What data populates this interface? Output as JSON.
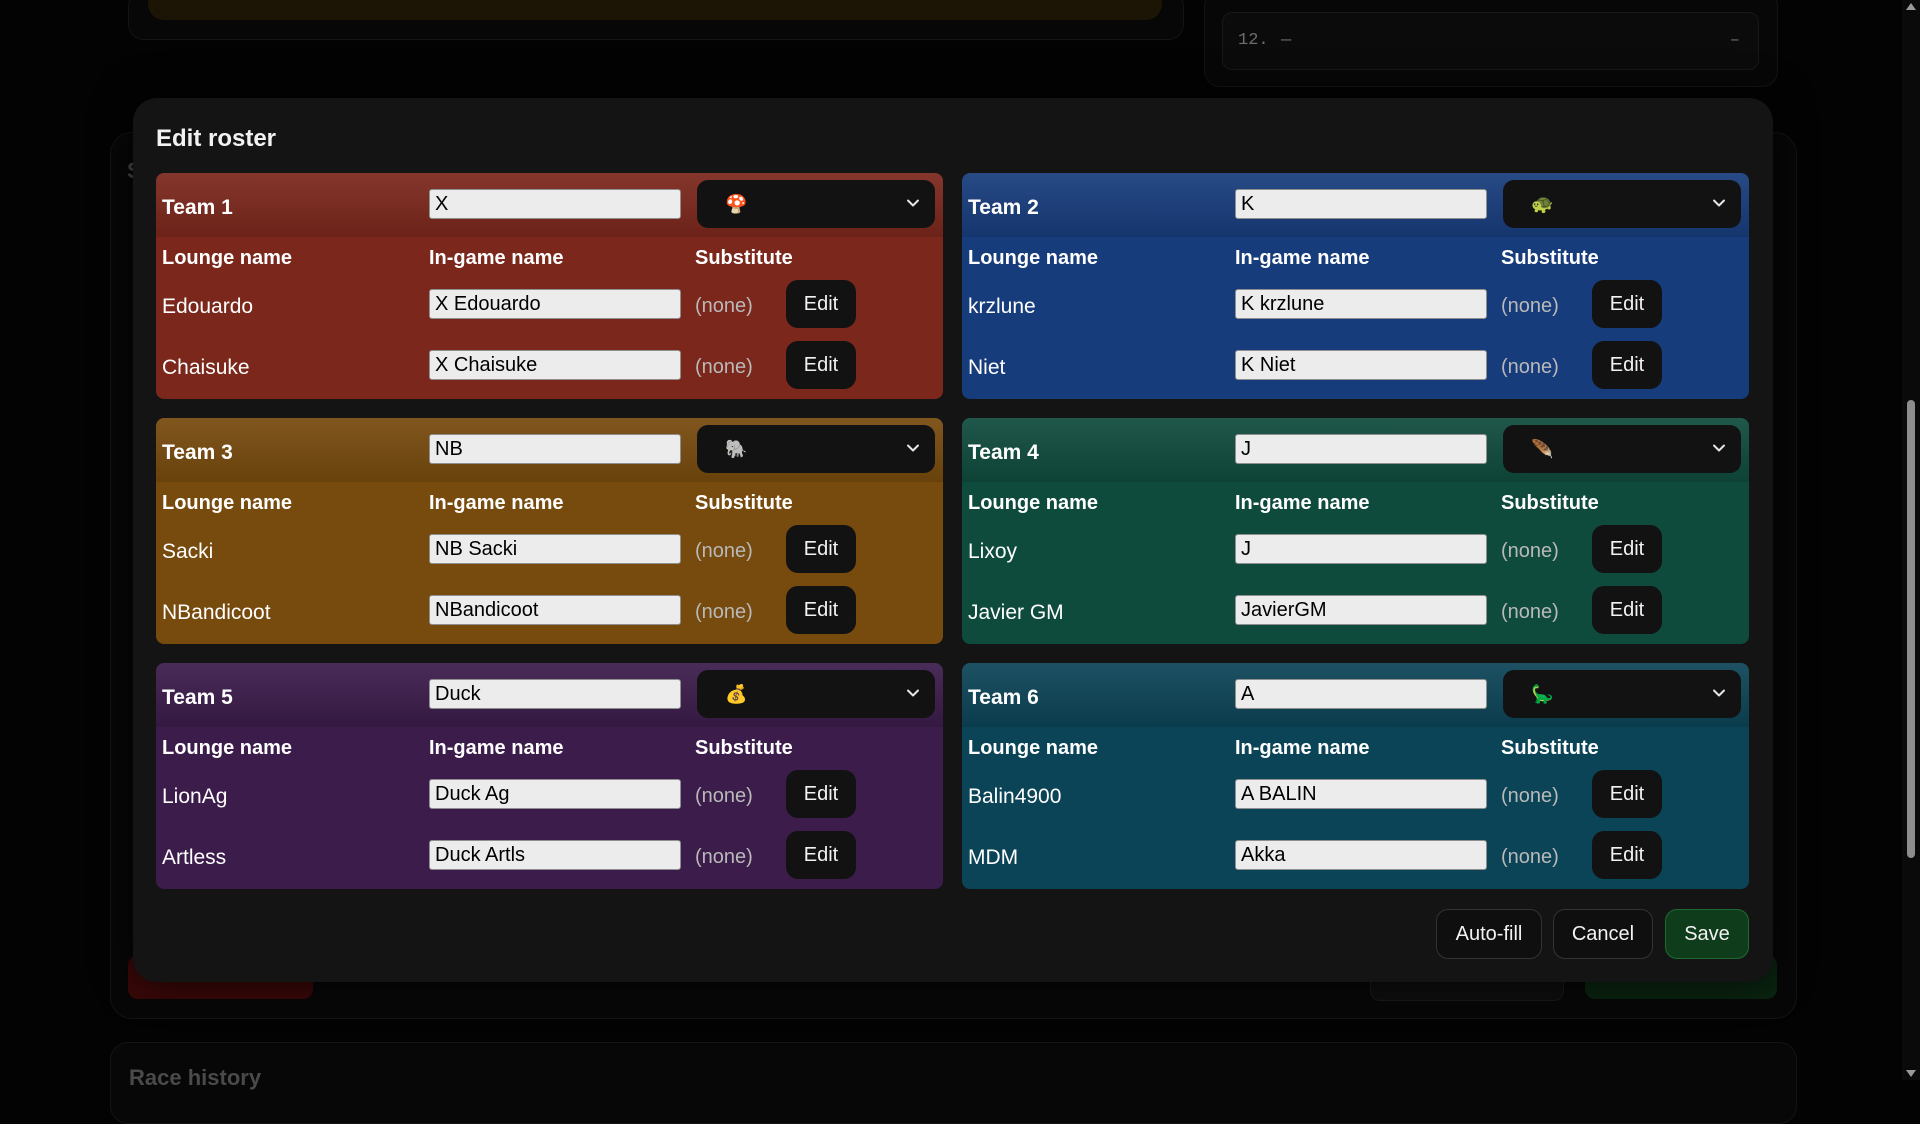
{
  "background": {
    "list_row": {
      "number": "12.",
      "name": "—",
      "value": "–"
    },
    "section_initial": "S",
    "race_history_title": "Race history"
  },
  "modal": {
    "title": "Edit roster",
    "column_headers": {
      "lounge": "Lounge name",
      "ingame": "In-game name",
      "substitute": "Substitute"
    },
    "none_label": "(none)",
    "edit_label": "Edit",
    "teams": [
      {
        "name": "Team 1",
        "tag": "X",
        "icon": "🍄",
        "color": "#7b271c",
        "players": [
          {
            "lounge": "Edouardo",
            "ingame": "X Edouardo"
          },
          {
            "lounge": "Chaisuke",
            "ingame": "X Chaisuke"
          }
        ]
      },
      {
        "name": "Team 2",
        "tag": "K",
        "icon": "🐢",
        "color": "#173c7c",
        "players": [
          {
            "lounge": "krzlune",
            "ingame": "K krzlune"
          },
          {
            "lounge": "Niet",
            "ingame": "K Niet"
          }
        ]
      },
      {
        "name": "Team 3",
        "tag": "NB",
        "icon": "🐘",
        "color": "#774a0d",
        "players": [
          {
            "lounge": "Sacki",
            "ingame": "NB Sacki"
          },
          {
            "lounge": "NBandicoot",
            "ingame": "NBandicoot"
          }
        ]
      },
      {
        "name": "Team 4",
        "tag": "J",
        "icon": "🪶",
        "color": "#0f4b3d",
        "players": [
          {
            "lounge": "Lixoy",
            "ingame": "J"
          },
          {
            "lounge": "Javier GM",
            "ingame": "JavierGM"
          }
        ]
      },
      {
        "name": "Team 5",
        "tag": "Duck",
        "icon": "💰",
        "color": "#3b1c4b",
        "players": [
          {
            "lounge": "LionAg",
            "ingame": "Duck Ag"
          },
          {
            "lounge": "Artless",
            "ingame": "Duck Artls"
          }
        ]
      },
      {
        "name": "Team 6",
        "tag": "A",
        "icon": "🦕",
        "color": "#0c4457",
        "players": [
          {
            "lounge": "Balin4900",
            "ingame": "A BALIN"
          },
          {
            "lounge": "MDM",
            "ingame": "Akka"
          }
        ]
      }
    ],
    "footer": {
      "autofill": "Auto-fill",
      "cancel": "Cancel",
      "save": "Save"
    }
  }
}
